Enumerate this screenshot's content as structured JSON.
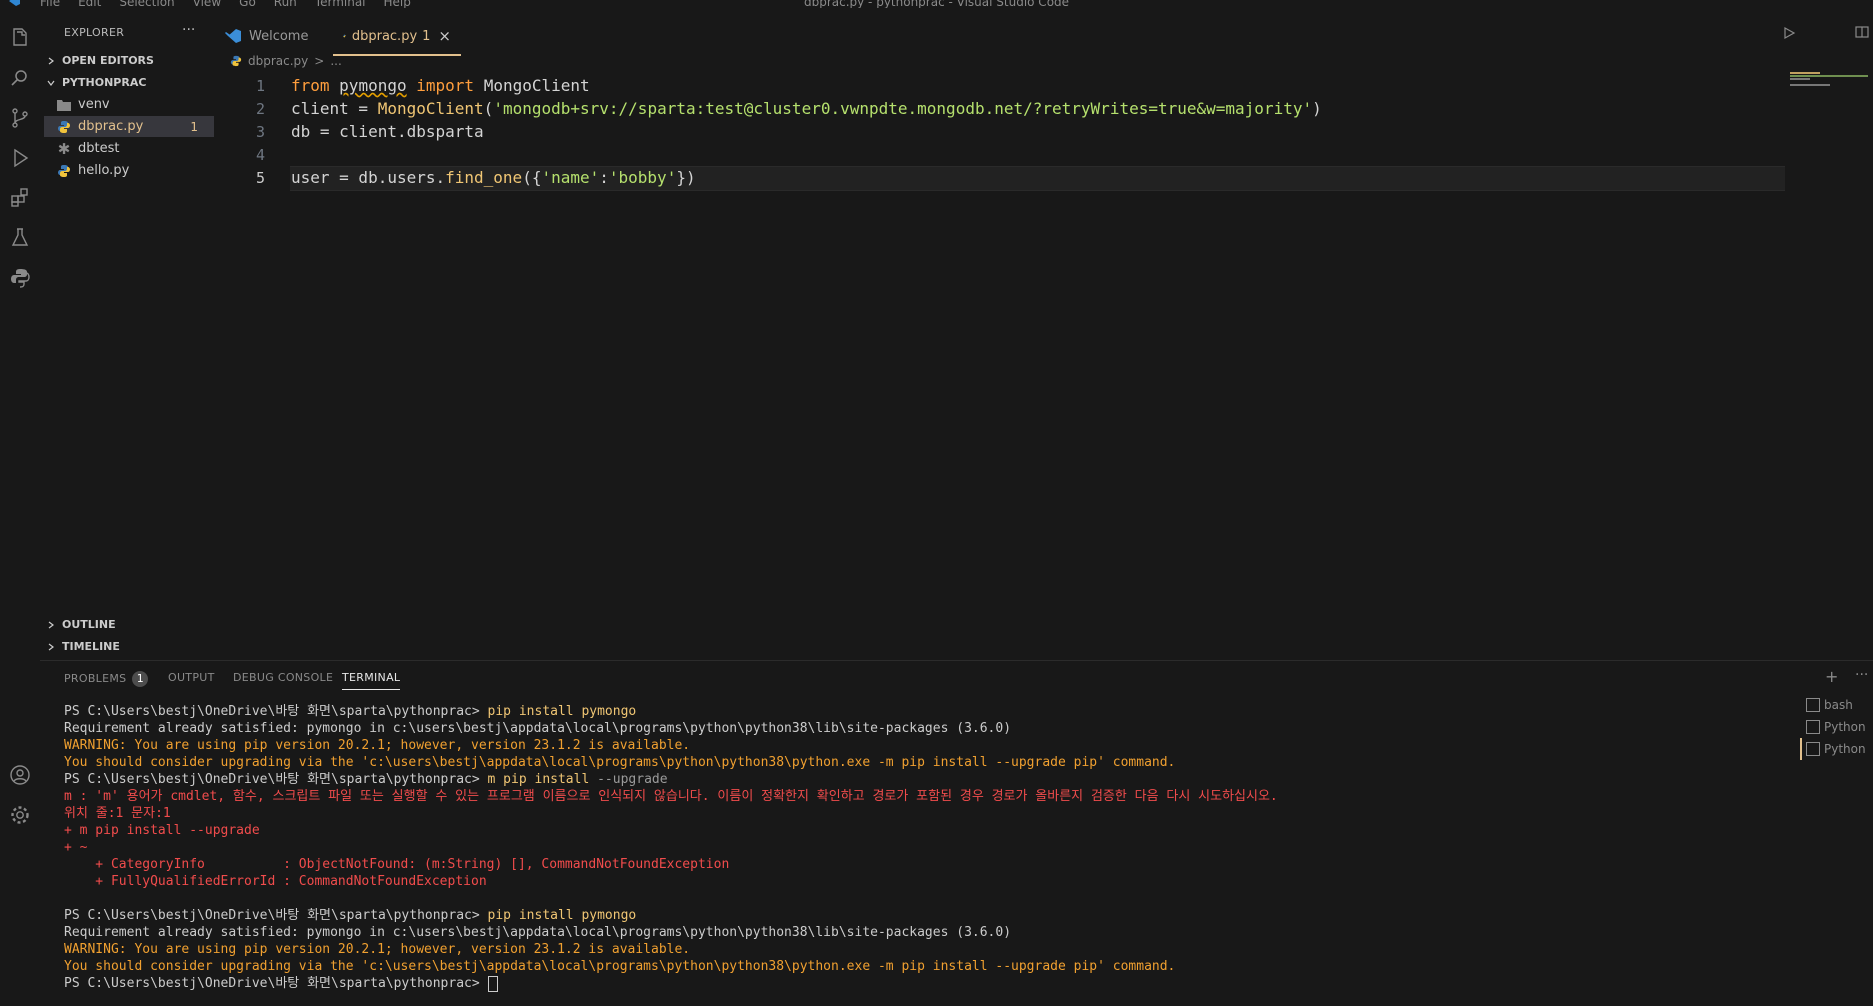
{
  "window": {
    "title": "dbprac.py - pythonprac - Visual Studio Code",
    "menu": [
      "File",
      "Edit",
      "Selection",
      "View",
      "Go",
      "Run",
      "Terminal",
      "Help"
    ]
  },
  "sidebar": {
    "header": "EXPLORER",
    "more": "···",
    "open_editors": "OPEN EDITORS",
    "project": "PYTHONPRAC",
    "items": [
      {
        "label": "venv",
        "type": "folder"
      },
      {
        "label": "dbprac.py",
        "type": "python",
        "badge": "1"
      },
      {
        "label": "dbtest",
        "type": "file"
      },
      {
        "label": "hello.py",
        "type": "python"
      }
    ],
    "outline": "OUTLINE",
    "timeline": "TIMELINE"
  },
  "tabs": [
    {
      "label": "Welcome"
    },
    {
      "label": "dbprac.py",
      "badge": "1",
      "close": "×"
    }
  ],
  "breadcrumb": {
    "file": "dbprac.py",
    "sep": ">",
    "more": "..."
  },
  "editor": {
    "lines": [
      {
        "num": "1"
      },
      {
        "num": "2"
      },
      {
        "num": "3"
      },
      {
        "num": "4"
      },
      {
        "num": "5"
      }
    ],
    "l1": {
      "kw1": "from",
      "mod": "pymongo",
      "kw2": "import",
      "cls": "MongoClient"
    },
    "l2": {
      "var": "client = ",
      "fn": "MongoClient",
      "open": "(",
      "str": "'mongodb+srv://sparta:test@cluster0.vwnpdte.mongodb.net/?retryWrites=true&w=majority'",
      "close": ")"
    },
    "l3": {
      "code": "db = client.dbsparta"
    },
    "l5": {
      "pre": "user = db.users.",
      "fn": "find_one",
      "open": "({",
      "k": "'name'",
      "colon": ":",
      "v": "'bobby'",
      "close": "})"
    }
  },
  "panel": {
    "tabs": {
      "problems": "PROBLEMS",
      "problems_count": "1",
      "output": "OUTPUT",
      "debug": "DEBUG CONSOLE",
      "terminal": "TERMINAL"
    },
    "terminals": [
      "bash",
      "Python",
      "Python"
    ],
    "lines": {
      "p1": "PS C:\\Users\\bestj\\OneDrive\\바탕 화면\\sparta\\pythonprac> ",
      "c1": "pip install pymongo",
      "r1": "Requirement already satisfied: pymongo in c:\\users\\bestj\\appdata\\local\\programs\\python\\python38\\lib\\site-packages (3.6.0)",
      "w1": "WARNING: You are using pip version 20.2.1; however, version 23.1.2 is available.",
      "w2": "You should consider upgrading via the 'c:\\users\\bestj\\appdata\\local\\programs\\python\\python38\\python.exe -m pip install --upgrade pip' command.",
      "p2": "PS C:\\Users\\bestj\\OneDrive\\바탕 화면\\sparta\\pythonprac> ",
      "c2": "m pip install ",
      "c2b": "--upgrade",
      "e1": "m : 'm' 용어가 cmdlet, 함수, 스크립트 파일 또는 실행할 수 있는 프로그램 이름으로 인식되지 않습니다. 이름이 정확한지 확인하고 경로가 포함된 경우 경로가 올바른지 검증한 다음 다시 시도하십시오.",
      "e2": "위치 줄:1 문자:1",
      "e3": "+ m pip install --upgrade",
      "e4": "+ ~",
      "e5": "    + CategoryInfo          : ObjectNotFound: (m:String) [], CommandNotFoundException",
      "e6": "    + FullyQualifiedErrorId : CommandNotFoundException",
      "p3": "PS C:\\Users\\bestj\\OneDrive\\바탕 화면\\sparta\\pythonprac> ",
      "c3": "pip install pymongo",
      "r2": "Requirement already satisfied: pymongo in c:\\users\\bestj\\appdata\\local\\programs\\python\\python38\\lib\\site-packages (3.6.0)",
      "w3": "WARNING: You are using pip version 20.2.1; however, version 23.1.2 is available.",
      "w4": "You should consider upgrading via the 'c:\\users\\bestj\\appdata\\local\\programs\\python\\python38\\python.exe -m pip install --upgrade pip' command.",
      "p4": "PS C:\\Users\\bestj\\OneDrive\\바탕 화면\\sparta\\pythonprac> "
    }
  },
  "colors": {
    "accent": "#e2c08d",
    "keyword": "#ff9e3d",
    "string": "#b5e06d",
    "error": "#f14c4c",
    "warning": "#f0a030"
  }
}
